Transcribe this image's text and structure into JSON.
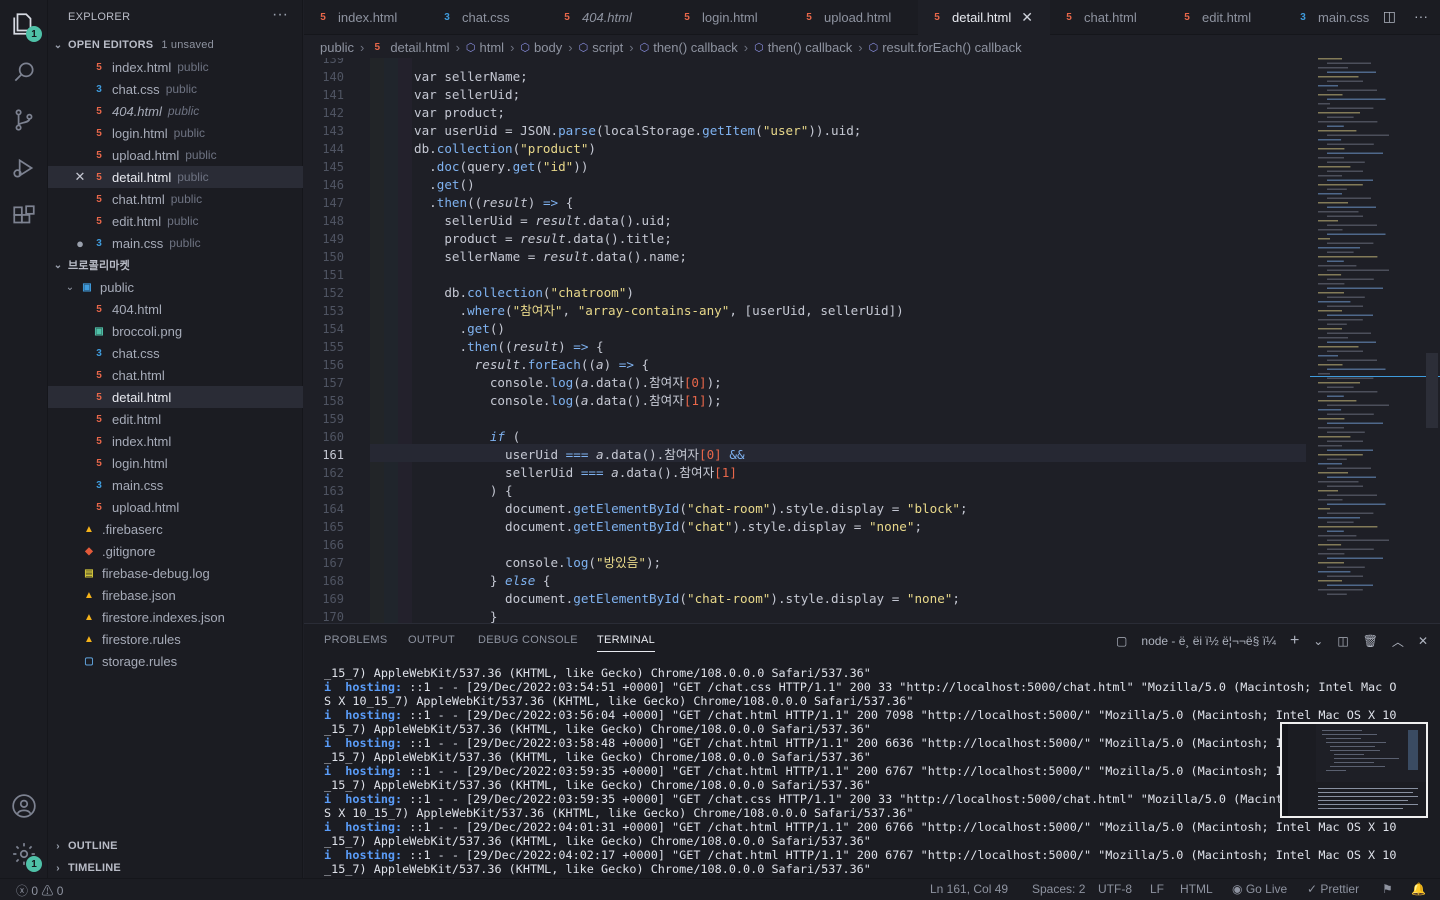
{
  "sidebar": {
    "title": "EXPLORER",
    "open_editors_label": "OPEN EDITORS",
    "unsaved_label": "1 unsaved",
    "open_editors": [
      {
        "name": "index.html",
        "folder": "public",
        "type": "html"
      },
      {
        "name": "chat.css",
        "folder": "public",
        "type": "css"
      },
      {
        "name": "404.html",
        "folder": "public",
        "type": "html",
        "italic": true
      },
      {
        "name": "login.html",
        "folder": "public",
        "type": "html"
      },
      {
        "name": "upload.html",
        "folder": "public",
        "type": "html"
      },
      {
        "name": "detail.html",
        "folder": "public",
        "type": "html",
        "active": true
      },
      {
        "name": "chat.html",
        "folder": "public",
        "type": "html"
      },
      {
        "name": "edit.html",
        "folder": "public",
        "type": "html"
      },
      {
        "name": "main.css",
        "folder": "public",
        "type": "css",
        "unsaved": true
      }
    ],
    "project_label": "브로콜리마켓",
    "public_folder": "public",
    "public_files": [
      {
        "name": "404.html",
        "type": "html"
      },
      {
        "name": "broccoli.png",
        "type": "png"
      },
      {
        "name": "chat.css",
        "type": "css"
      },
      {
        "name": "chat.html",
        "type": "html"
      },
      {
        "name": "detail.html",
        "type": "html",
        "selected": true
      },
      {
        "name": "edit.html",
        "type": "html"
      },
      {
        "name": "index.html",
        "type": "html"
      },
      {
        "name": "login.html",
        "type": "html"
      },
      {
        "name": "main.css",
        "type": "css"
      },
      {
        "name": "upload.html",
        "type": "html"
      }
    ],
    "root_files": [
      {
        "name": ".firebaserc",
        "type": "fb"
      },
      {
        "name": ".gitignore",
        "type": "git"
      },
      {
        "name": "firebase-debug.log",
        "type": "log"
      },
      {
        "name": "firebase.json",
        "type": "fb"
      },
      {
        "name": "firestore.indexes.json",
        "type": "fb"
      },
      {
        "name": "firestore.rules",
        "type": "fb"
      },
      {
        "name": "storage.rules",
        "type": "rules"
      }
    ],
    "outline_label": "OUTLINE",
    "timeline_label": "TIMELINE"
  },
  "activity": {
    "explorer_badge": "1",
    "settings_badge": "1"
  },
  "tabs": [
    {
      "name": "index.html",
      "type": "html"
    },
    {
      "name": "chat.css",
      "type": "css"
    },
    {
      "name": "404.html",
      "type": "html",
      "italic": true
    },
    {
      "name": "login.html",
      "type": "html"
    },
    {
      "name": "upload.html",
      "type": "html"
    },
    {
      "name": "detail.html",
      "type": "html",
      "active": true
    },
    {
      "name": "chat.html",
      "type": "html"
    },
    {
      "name": "edit.html",
      "type": "html"
    },
    {
      "name": "main.css",
      "type": "css"
    }
  ],
  "breadcrumb": [
    "public",
    "detail.html",
    "html",
    "body",
    "script",
    "then() callback",
    "then() callback",
    "result.forEach() callback"
  ],
  "editor": {
    "current_line": "161",
    "lines": [
      {
        "n": "139",
        "code": ""
      },
      {
        "n": "140",
        "code": "var sellerName;"
      },
      {
        "n": "141",
        "code": "var sellerUid;"
      },
      {
        "n": "142",
        "code": "var product;"
      },
      {
        "n": "143",
        "code": "var userUid = JSON.parse(localStorage.getItem(\"user\")).uid;"
      },
      {
        "n": "144",
        "code": "db.collection(\"product\")"
      },
      {
        "n": "145",
        "code": "  .doc(query.get(\"id\"))"
      },
      {
        "n": "146",
        "code": "  .get()"
      },
      {
        "n": "147",
        "code": "  .then((result) => {"
      },
      {
        "n": "148",
        "code": "    sellerUid = result.data().uid;"
      },
      {
        "n": "149",
        "code": "    product = result.data().title;"
      },
      {
        "n": "150",
        "code": "    sellerName = result.data().name;"
      },
      {
        "n": "151",
        "code": ""
      },
      {
        "n": "152",
        "code": "    db.collection(\"chatroom\")"
      },
      {
        "n": "153",
        "code": "      .where(\"참여자\", \"array-contains-any\", [userUid, sellerUid])"
      },
      {
        "n": "154",
        "code": "      .get()"
      },
      {
        "n": "155",
        "code": "      .then((result) => {"
      },
      {
        "n": "156",
        "code": "        result.forEach((a) => {"
      },
      {
        "n": "157",
        "code": "          console.log(a.data().참여자[0]);"
      },
      {
        "n": "158",
        "code": "          console.log(a.data().참여자[1]);"
      },
      {
        "n": "159",
        "code": ""
      },
      {
        "n": "160",
        "code": "          if ("
      },
      {
        "n": "161",
        "code": "            userUid === a.data().참여자[0] &&"
      },
      {
        "n": "162",
        "code": "            sellerUid === a.data().참여자[1]"
      },
      {
        "n": "163",
        "code": "          ) {"
      },
      {
        "n": "164",
        "code": "            document.getElementById(\"chat-room\").style.display = \"block\";"
      },
      {
        "n": "165",
        "code": "            document.getElementById(\"chat\").style.display = \"none\";"
      },
      {
        "n": "166",
        "code": ""
      },
      {
        "n": "167",
        "code": "            console.log(\"방있음\");"
      },
      {
        "n": "168",
        "code": "          } else {"
      },
      {
        "n": "169",
        "code": "            document.getElementById(\"chat-room\").style.display = \"none\";"
      },
      {
        "n": "170",
        "code": "          }"
      }
    ]
  },
  "panel": {
    "tabs": [
      "PROBLEMS",
      "OUTPUT",
      "DEBUG CONSOLE",
      "TERMINAL"
    ],
    "active_tab": "TERMINAL",
    "terminal_name": "node - ë¸ ëi ï½ ë¦¬¬ë§ ï¼",
    "terminal_lines": [
      {
        "prefix": "",
        "text": "_15_7) AppleWebKit/537.36 (KHTML, like Gecko) Chrome/108.0.0.0 Safari/537.36\""
      },
      {
        "prefix": "i  hosting:",
        "text": " ::1 - - [29/Dec/2022:03:54:51 +0000] \"GET /chat.css HTTP/1.1\" 200 33 \"http://localhost:5000/chat.html\" \"Mozilla/5.0 (Macintosh; Intel Mac O"
      },
      {
        "prefix": "",
        "text": "S X 10_15_7) AppleWebKit/537.36 (KHTML, like Gecko) Chrome/108.0.0.0 Safari/537.36\""
      },
      {
        "prefix": "i  hosting:",
        "text": " ::1 - - [29/Dec/2022:03:56:04 +0000] \"GET /chat.html HTTP/1.1\" 200 7098 \"http://localhost:5000/\" \"Mozilla/5.0 (Macintosh; Intel Mac OS X 10"
      },
      {
        "prefix": "",
        "text": "_15_7) AppleWebKit/537.36 (KHTML, like Gecko) Chrome/108.0.0.0 Safari/537.36\""
      },
      {
        "prefix": "i  hosting:",
        "text": " ::1 - - [29/Dec/2022:03:58:48 +0000] \"GET /chat.html HTTP/1.1\" 200 6636 \"http://localhost:5000/\" \"Mozilla/5.0 (Macintosh; In"
      },
      {
        "prefix": "",
        "text": "_15_7) AppleWebKit/537.36 (KHTML, like Gecko) Chrome/108.0.0.0 Safari/537.36\""
      },
      {
        "prefix": "i  hosting:",
        "text": " ::1 - - [29/Dec/2022:03:59:35 +0000] \"GET /chat.html HTTP/1.1\" 200 6767 \"http://localhost:5000/\" \"Mozilla/5.0 (Macintosh; In"
      },
      {
        "prefix": "",
        "text": "_15_7) AppleWebKit/537.36 (KHTML, like Gecko) Chrome/108.0.0.0 Safari/537.36\""
      },
      {
        "prefix": "i  hosting:",
        "text": " ::1 - - [29/Dec/2022:03:59:35 +0000] \"GET /chat.css HTTP/1.1\" 200 33 \"http://localhost:5000/chat.html\" \"Mozilla/5.0 (Macinto"
      },
      {
        "prefix": "",
        "text": "S X 10_15_7) AppleWebKit/537.36 (KHTML, like Gecko) Chrome/108.0.0.0 Safari/537.36\""
      },
      {
        "prefix": "i  hosting:",
        "text": " ::1 - - [29/Dec/2022:04:01:31 +0000] \"GET /chat.html HTTP/1.1\" 200 6766 \"http://localhost:5000/\" \"Mozilla/5.0 (Macintosh; Intel Mac OS X 10"
      },
      {
        "prefix": "",
        "text": "_15_7) AppleWebKit/537.36 (KHTML, like Gecko) Chrome/108.0.0.0 Safari/537.36\""
      },
      {
        "prefix": "i  hosting:",
        "text": " ::1 - - [29/Dec/2022:04:02:17 +0000] \"GET /chat.html HTTP/1.1\" 200 6767 \"http://localhost:5000/\" \"Mozilla/5.0 (Macintosh; Intel Mac OS X 10"
      },
      {
        "prefix": "",
        "text": "_15_7) AppleWebKit/537.36 (KHTML, like Gecko) Chrome/108.0.0.0 Safari/537.36\""
      }
    ]
  },
  "status": {
    "errors": "0",
    "warnings": "0",
    "position": "Ln 161, Col 49",
    "spaces": "Spaces: 2",
    "encoding": "UTF-8",
    "eol": "LF",
    "language": "HTML",
    "go_live": "Go Live",
    "prettier": "Prettier"
  },
  "colors": {
    "accent": "#4fc1a8",
    "html_icon": "#e8674a",
    "css_icon": "#3f9bdc",
    "string": "#e8d88a",
    "function": "#7fb2f0"
  }
}
